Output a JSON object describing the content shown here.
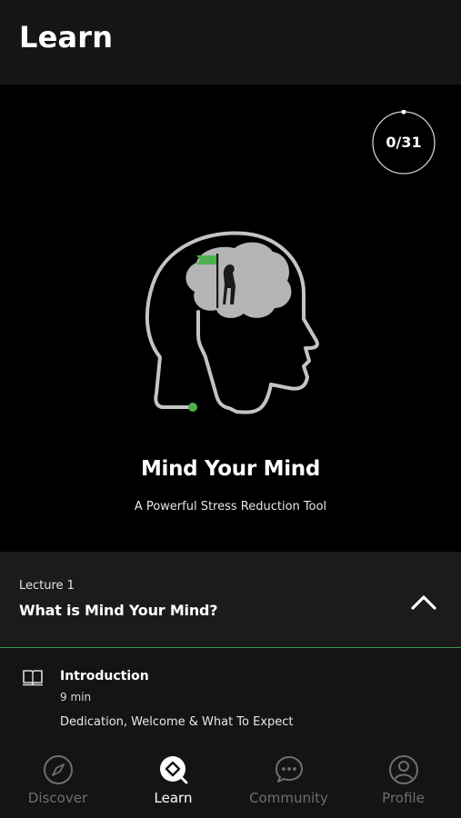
{
  "header": {
    "title": "Learn"
  },
  "course": {
    "progress": "0/31",
    "progress_fraction": 0,
    "title": "Mind Your Mind",
    "subtitle": "A Powerful Stress Reduction Tool"
  },
  "lecture": {
    "number": "Lecture 1",
    "title": "What is Mind Your Mind?"
  },
  "lesson": {
    "title": "Introduction",
    "duration": "9 min",
    "description": "Dedication, Welcome & What To Expect"
  },
  "tabs": [
    {
      "label": "Discover",
      "icon": "compass-icon",
      "active": false
    },
    {
      "label": "Learn",
      "icon": "learn-icon",
      "active": true
    },
    {
      "label": "Community",
      "icon": "chat-bubble-icon",
      "active": false
    },
    {
      "label": "Profile",
      "icon": "profile-icon",
      "active": false
    }
  ],
  "colors": {
    "accent_green": "#3f9b45",
    "background": "#141414",
    "hero_background": "#000000"
  }
}
